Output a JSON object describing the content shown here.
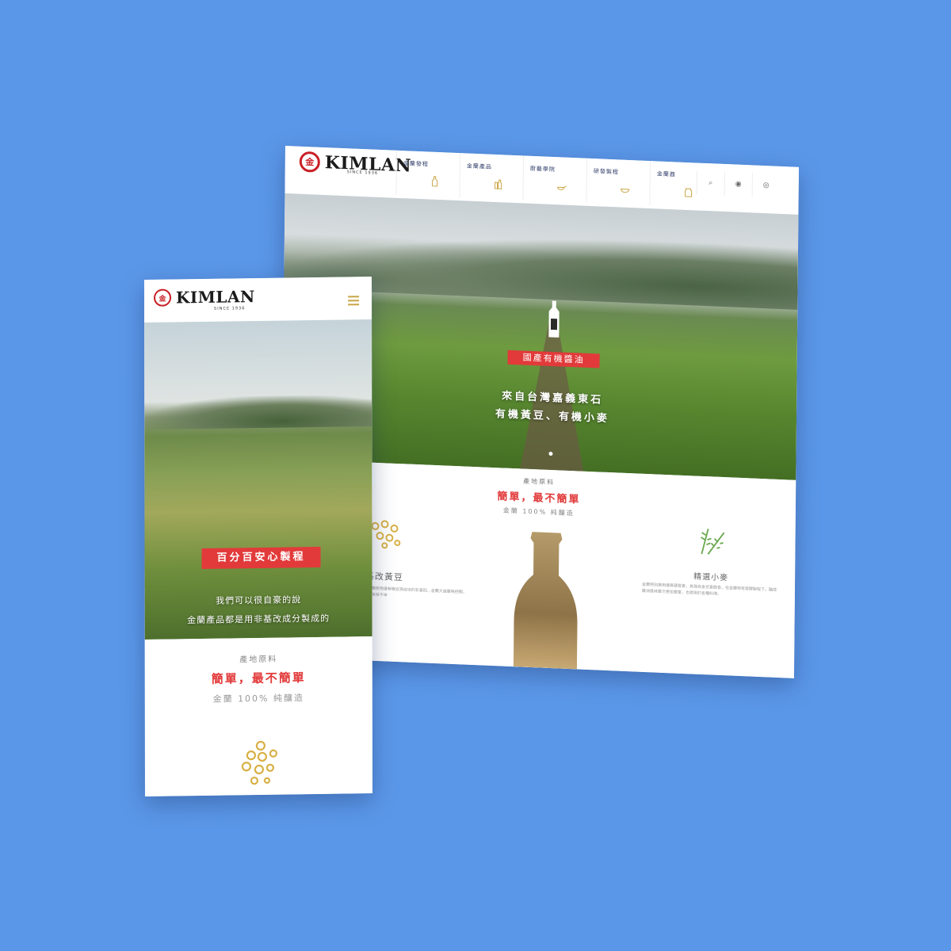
{
  "colors": {
    "background": "#5b97e8",
    "accent_red": "#e23a3a",
    "brand_gold": "#c9a543",
    "nav_text": "#2b3a67"
  },
  "brand": {
    "name": "KIMLAN",
    "since_desktop": "SINCE 1936",
    "since_mobile": "SINCE 1936",
    "seal_char": "金"
  },
  "desktop": {
    "nav": [
      {
        "label": "金蘭發程",
        "icon": "bottle-icon"
      },
      {
        "label": "金蘭產品",
        "icon": "bottles-icon"
      },
      {
        "label": "廚藝學院",
        "icon": "pan-icon"
      },
      {
        "label": "研發製程",
        "icon": "bowl-icon"
      },
      {
        "label": "金蘭酉",
        "icon": "jar-icon"
      }
    ],
    "utilities": {
      "search": "⌕",
      "account": "◉",
      "language": "◎"
    },
    "hero": {
      "tag": "國產有機醬油",
      "line1": "來自台灣嘉義東石",
      "line2": "有機黃豆、有機小麥"
    },
    "section": {
      "eyebrow": "產地原料",
      "title": "簡單，最不簡單",
      "subtitle": "金蘭 100% 純釀造",
      "soy_title": "基改黃豆",
      "soy_desc": "，金蘭使用僅有機豆源自培的非基因…金蘭大進嚴格把關，吃起來味不申",
      "wheat_title": "精選小麥",
      "wheat_desc": "金蘭特別選用優質硬質麥，具強自身豆麥醇香，在金蘭特有發酵製程下，釀成醬油風味層次更加豐富，也使用於各種料理。"
    }
  },
  "mobile": {
    "hero": {
      "tag": "百分百安心製程",
      "line1": "我們可以很自豪的說",
      "line2": "金蘭產品都是用非基改成分製成的"
    },
    "section": {
      "eyebrow": "產地原料",
      "title": "簡單，最不簡單",
      "subtitle": "金蘭 100% 純釀造"
    }
  }
}
